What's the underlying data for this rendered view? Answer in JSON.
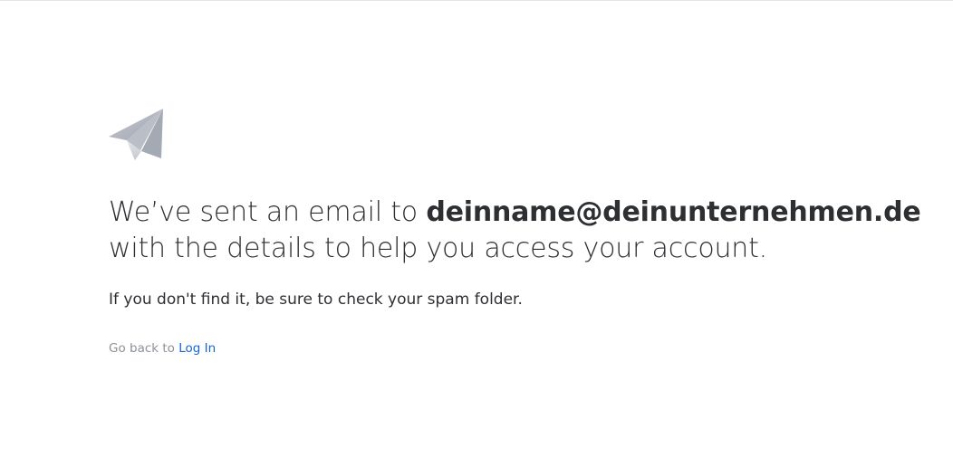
{
  "icon": "paper-plane-icon",
  "colors": {
    "accent_link": "#1565d8",
    "muted_text": "#8c9199",
    "icon_gray": "#aeb3bd"
  },
  "message": {
    "prefix": "We’ve sent an email to ",
    "email": "deinname@deinunternehmen.de",
    "line2": "with the details to help you access your account."
  },
  "hint": "If you don't find it, be sure to check your spam folder.",
  "back": {
    "prefix": "Go back to ",
    "link_label": "Log In"
  }
}
